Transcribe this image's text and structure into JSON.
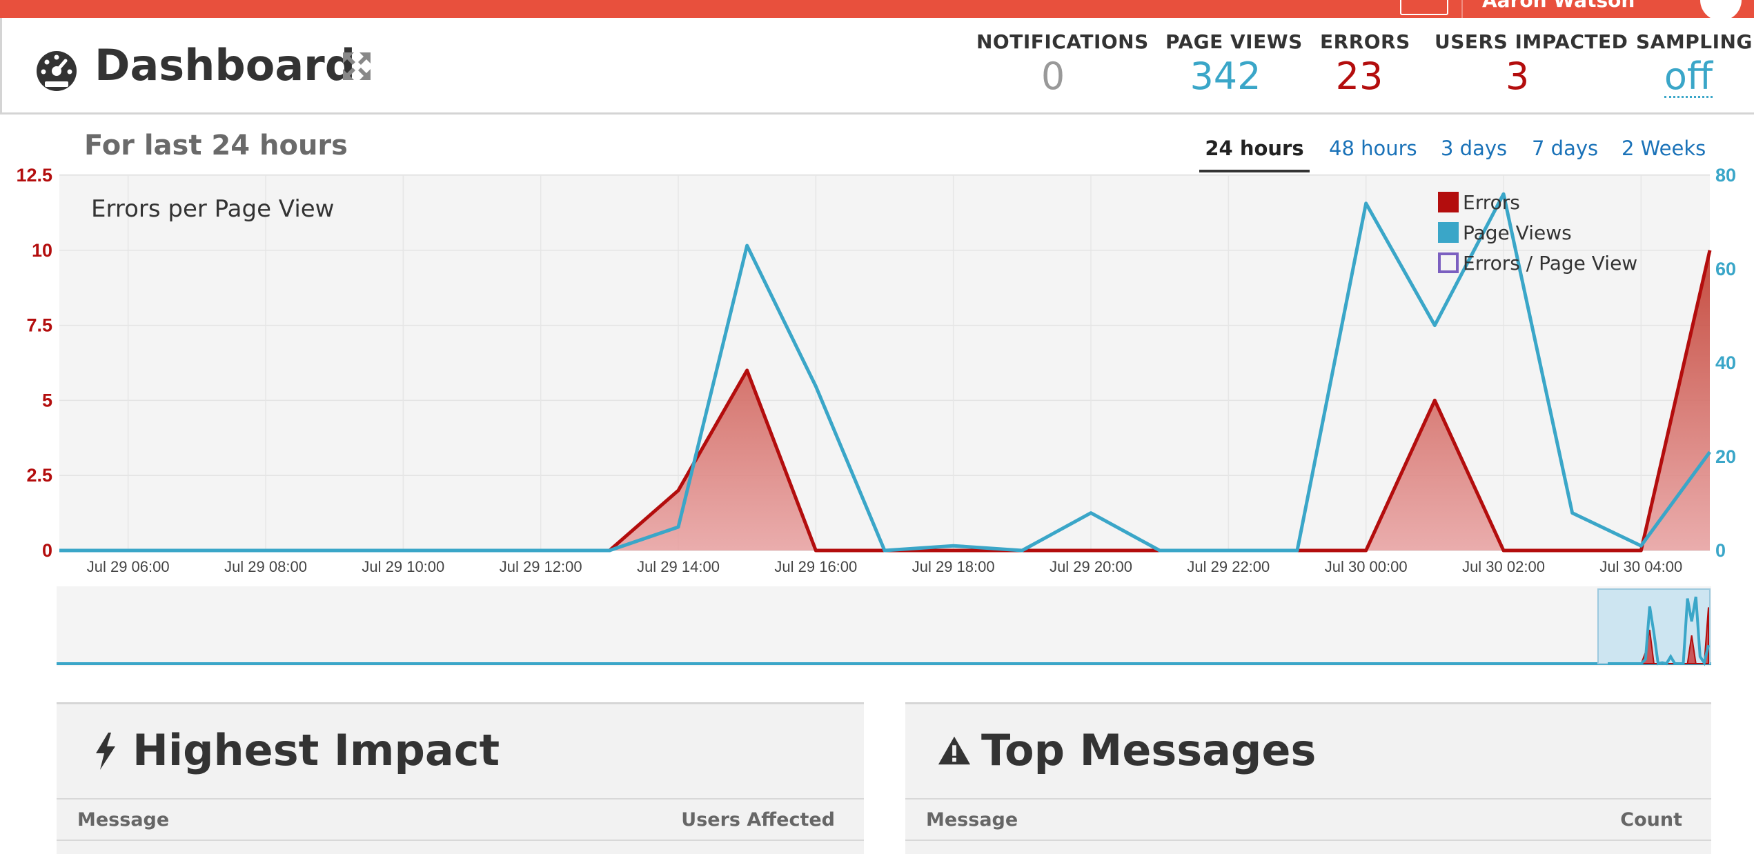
{
  "topbar": {
    "user_name": "Aaron Watson"
  },
  "header": {
    "title": "Dashboard",
    "stats": {
      "notifications": {
        "label": "NOTIFICATIONS",
        "value": "0"
      },
      "page_views": {
        "label": "PAGE VIEWS",
        "value": "342"
      },
      "errors": {
        "label": "ERRORS",
        "value": "23"
      },
      "users_impacted": {
        "label": "USERS IMPACTED",
        "value": "3"
      },
      "sampling": {
        "label": "SAMPLING",
        "value": "off"
      }
    }
  },
  "range": {
    "heading": "For last 24 hours",
    "tabs": [
      "24 hours",
      "48 hours",
      "3 days",
      "7 days",
      "2 Weeks"
    ],
    "active_tab": 0
  },
  "colors": {
    "errors": "#b30d0d",
    "page_views": "#3aa6c8",
    "ratio": "#7b5fc0",
    "topbar": "#e8503d"
  },
  "chart_data": {
    "type": "line",
    "title": "Errors per Page View",
    "x": [
      "Jul 29 05:00",
      "Jul 29 06:00",
      "Jul 29 07:00",
      "Jul 29 08:00",
      "Jul 29 09:00",
      "Jul 29 10:00",
      "Jul 29 11:00",
      "Jul 29 12:00",
      "Jul 29 13:00",
      "Jul 29 14:00",
      "Jul 29 15:00",
      "Jul 29 16:00",
      "Jul 29 17:00",
      "Jul 29 18:00",
      "Jul 29 19:00",
      "Jul 29 20:00",
      "Jul 29 21:00",
      "Jul 29 22:00",
      "Jul 29 23:00",
      "Jul 30 00:00",
      "Jul 30 01:00",
      "Jul 30 02:00",
      "Jul 30 03:00",
      "Jul 30 04:00",
      "Jul 30 05:00"
    ],
    "x_ticks": [
      "Jul 29 06:00",
      "Jul 29 08:00",
      "Jul 29 10:00",
      "Jul 29 12:00",
      "Jul 29 14:00",
      "Jul 29 16:00",
      "Jul 29 18:00",
      "Jul 29 20:00",
      "Jul 29 22:00",
      "Jul 30 00:00",
      "Jul 30 02:00",
      "Jul 30 04:00"
    ],
    "series": [
      {
        "name": "Errors",
        "axis": "left",
        "type": "area",
        "values": [
          0,
          0,
          0,
          0,
          0,
          0,
          0,
          0,
          0,
          2,
          6,
          0,
          0,
          0,
          0,
          0,
          0,
          0,
          0,
          0,
          5,
          0,
          0,
          0,
          10
        ]
      },
      {
        "name": "Page Views",
        "axis": "right",
        "type": "line",
        "values": [
          0,
          0,
          0,
          0,
          0,
          0,
          0,
          0,
          0,
          5,
          65,
          35,
          0,
          1,
          0,
          8,
          0,
          0,
          0,
          74,
          48,
          76,
          8,
          1,
          21
        ]
      },
      {
        "name": "Errors / Page View",
        "axis": "left",
        "type": "line",
        "values": []
      }
    ],
    "y_left": {
      "ticks": [
        "0",
        "2.5",
        "5",
        "7.5",
        "10",
        "12.5"
      ],
      "range": [
        0,
        12.5
      ]
    },
    "y_right": {
      "ticks": [
        "0",
        "20",
        "40",
        "60",
        "80"
      ],
      "range": [
        0,
        80
      ]
    },
    "legend": [
      "Errors",
      "Page Views",
      "Errors / Page View"
    ],
    "legend_position": "top-right",
    "grid": true
  },
  "panels": {
    "highest_impact": {
      "title": "Highest Impact",
      "col_message": "Message",
      "col_metric": "Users Affected"
    },
    "top_messages": {
      "title": "Top Messages",
      "col_message": "Message",
      "col_metric": "Count"
    }
  }
}
